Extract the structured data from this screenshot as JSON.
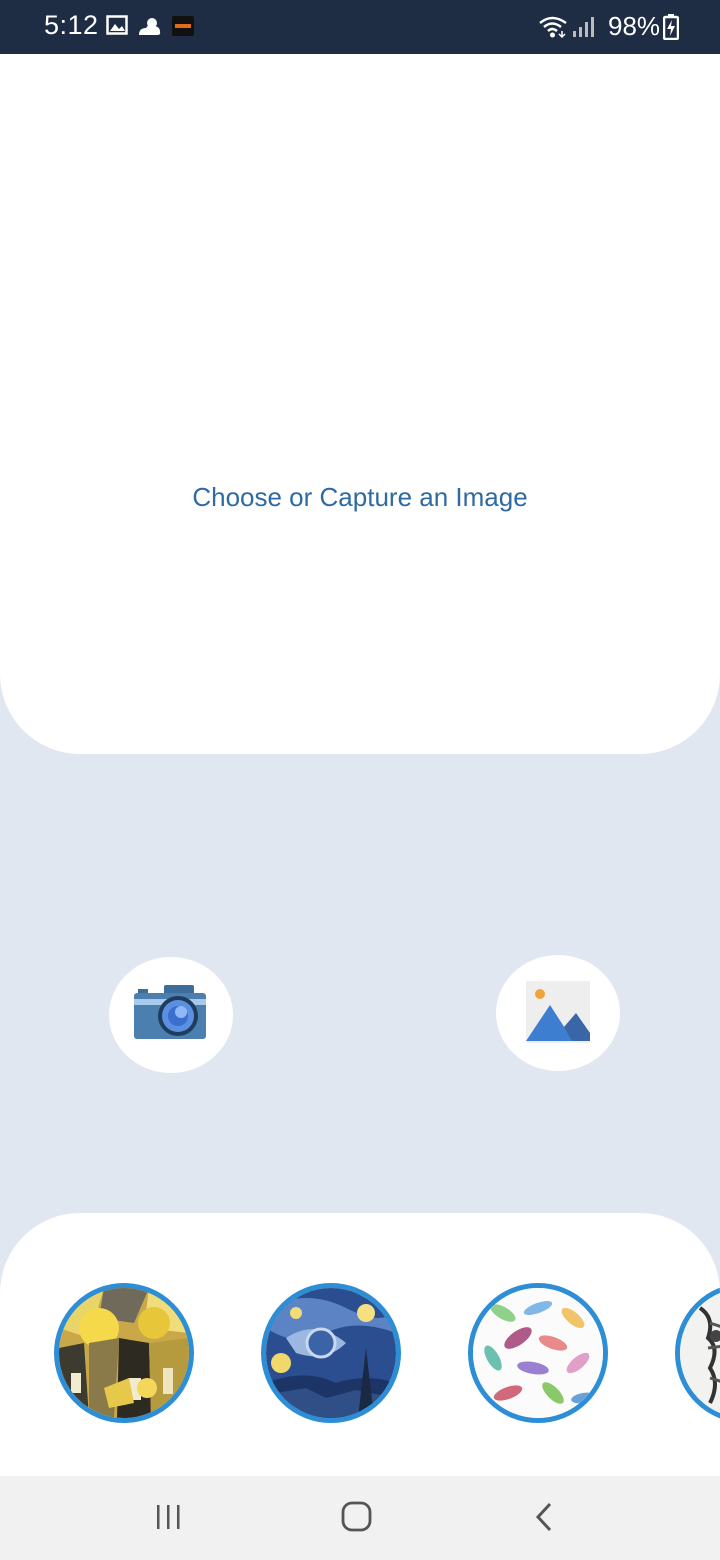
{
  "status_bar": {
    "time": "5:12",
    "battery": "98%",
    "icons": [
      "image-notification-icon",
      "weather-icon",
      "app-notification-icon",
      "wifi-icon",
      "signal-icon",
      "battery-charging-icon"
    ]
  },
  "main": {
    "prompt": "Choose or Capture an Image"
  },
  "actions": {
    "camera_icon": "camera-icon",
    "gallery_icon": "gallery-icon"
  },
  "styles": {
    "items": [
      {
        "name": "style-cubist-yellow"
      },
      {
        "name": "style-starry-night"
      },
      {
        "name": "style-watercolor-feathers"
      },
      {
        "name": "style-sketch"
      }
    ]
  },
  "nav": {
    "icons": [
      "recent-apps-icon",
      "home-icon",
      "back-icon"
    ]
  },
  "colors": {
    "status_bar": "#1f2d44",
    "background": "#e1e7f0",
    "accent": "#2d8ed6",
    "prompt_text": "#2f6aa3"
  }
}
